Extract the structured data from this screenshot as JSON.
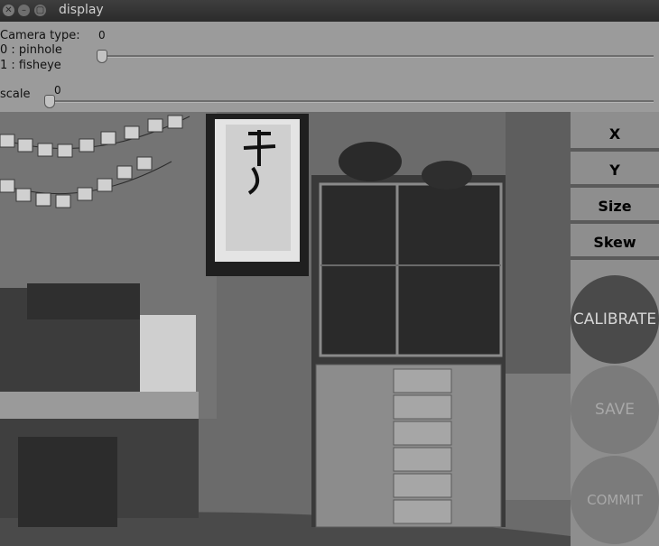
{
  "window": {
    "title": "display"
  },
  "controls": {
    "camera_type": {
      "label": "Camera type:",
      "option0": "0 : pinhole",
      "option1": "1 : fisheye",
      "value": "0"
    },
    "scale": {
      "label": "scale",
      "value": "0"
    }
  },
  "panel": {
    "metrics": [
      {
        "label": "X",
        "level": 0.0
      },
      {
        "label": "Y",
        "level": 0.0
      },
      {
        "label": "Size",
        "level": 0.0
      },
      {
        "label": "Skew",
        "level": 0.0
      }
    ],
    "buttons": {
      "calibrate": "CALIBRATE",
      "save": "SAVE",
      "commit": "COMMIT"
    }
  }
}
